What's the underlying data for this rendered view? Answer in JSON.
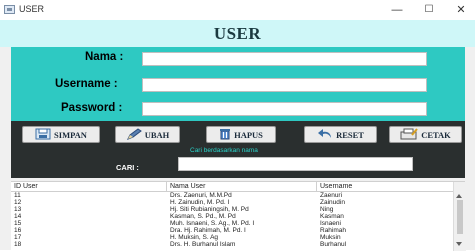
{
  "window": {
    "title": "USER",
    "icon": "app-window-icon",
    "controls": {
      "minimize": "—",
      "maximize": "☐",
      "close": "✕"
    }
  },
  "header": {
    "title": "USER"
  },
  "form": {
    "nama_label": "Nama :",
    "username_label": "Username :",
    "password_label": "Password :",
    "nama_value": "",
    "username_value": "",
    "password_value": ""
  },
  "buttons": {
    "simpan": "SIMPAN",
    "ubah": "UBAH",
    "hapus": "HAPUS",
    "reset": "RESET",
    "cetak": "CETAK"
  },
  "search": {
    "hint": "Cari berdasarkan nama",
    "label": "CARI :",
    "value": ""
  },
  "table": {
    "headers": [
      "ID User",
      "Nama User",
      "Username"
    ],
    "rows": [
      [
        "11",
        "Drs. Zaenuri, M.M.Pd",
        "Zaenuri"
      ],
      [
        "12",
        "H. Zainudin, M. Pd. I",
        "Zainudin"
      ],
      [
        "13",
        "Hj. Siti Rubianingsih, M. Pd",
        "Ning"
      ],
      [
        "14",
        "Kasman, S. Pd., M. Pd",
        "Kasman"
      ],
      [
        "15",
        "Muh. Isnaeni, S. Ag., M. Pd. I",
        "Isnaeni"
      ],
      [
        "16",
        "Dra. Hj. Rahimah, M. Pd. I",
        "Rahimah"
      ],
      [
        "17",
        "H. Muksin, S. Ag",
        "Muksin"
      ],
      [
        "18",
        "Drs. H. Burhanul Islam",
        "Burhanul"
      ]
    ]
  },
  "colors": {
    "header_bg": "#cff7f8",
    "form_bg": "#2ec9c2",
    "button_panel_bg": "#2a2f2f",
    "hint_text": "#29d3c9"
  }
}
